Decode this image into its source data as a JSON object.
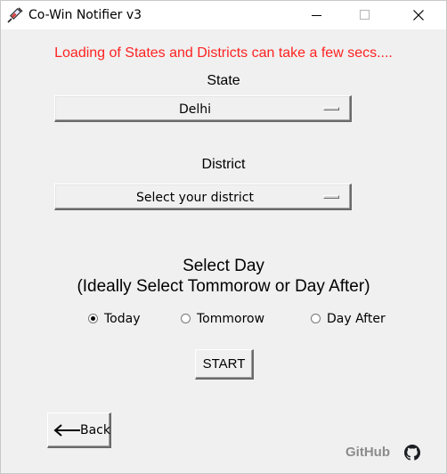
{
  "window": {
    "title": "Co-Win Notifier v3"
  },
  "notice": "Loading of States and Districts can take a few secs....",
  "state": {
    "label": "State",
    "selected": "Delhi"
  },
  "district": {
    "label": "District",
    "selected": "Select your district"
  },
  "day": {
    "heading_line1": "Select Day",
    "heading_line2": "(Ideally Select Tommorow or Day After)",
    "options": [
      {
        "label": "Today",
        "checked": true
      },
      {
        "label": "Tommorow",
        "checked": false
      },
      {
        "label": "Day After",
        "checked": false
      }
    ]
  },
  "actions": {
    "start_label": "START",
    "back_label": "Back"
  },
  "footer": {
    "github_label": "GitHub"
  },
  "icons": {
    "app": "syringe-icon",
    "back": "arrow-left-icon",
    "github": "github-icon"
  },
  "colors": {
    "notice": "#ff2222",
    "background": "#f0f0f0",
    "github_text": "#8c8c8c"
  }
}
